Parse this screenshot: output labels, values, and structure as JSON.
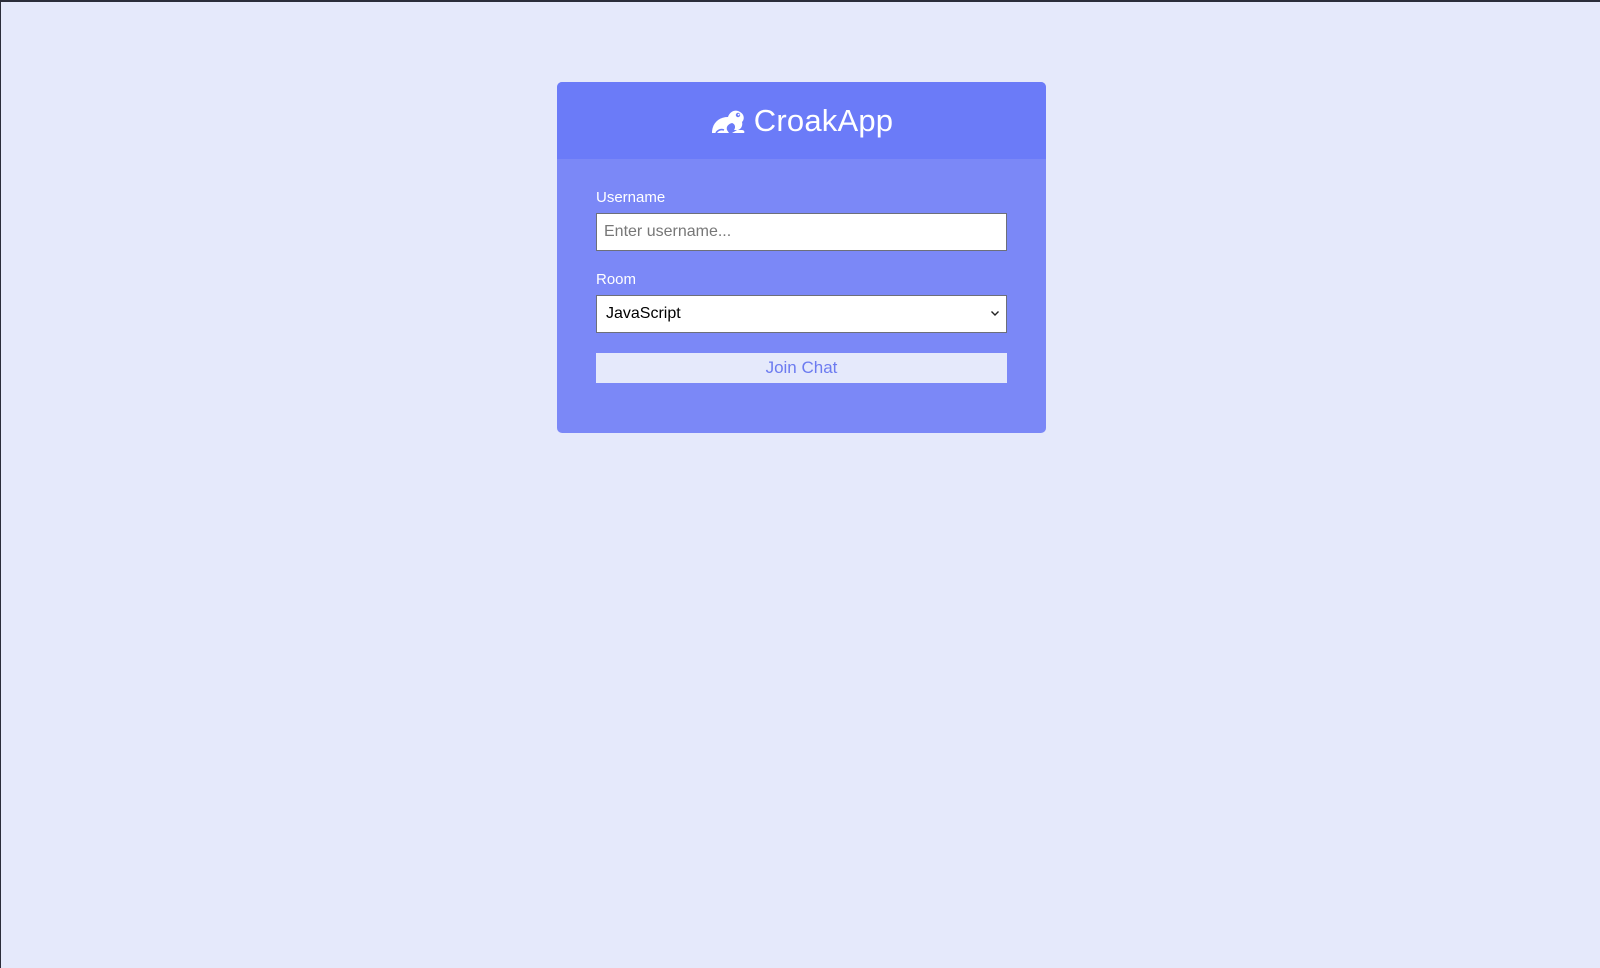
{
  "app": {
    "title": "CroakApp",
    "logo_icon": "frog-icon"
  },
  "form": {
    "username_label": "Username",
    "username_placeholder": "Enter username...",
    "username_value": "",
    "room_label": "Room",
    "room_selected": "JavaScript",
    "join_button_label": "Join Chat"
  },
  "colors": {
    "background": "#e5e9fb",
    "header": "#6b7bf8",
    "card_body": "#7b88f7",
    "button_bg": "#e5e9fb",
    "button_text": "#6c7bf0"
  }
}
